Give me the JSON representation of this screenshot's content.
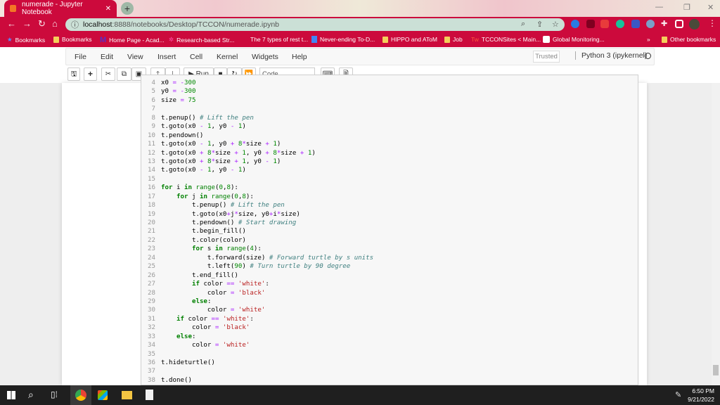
{
  "browser": {
    "tab_title": "numerade - Jupyter Notebook",
    "url_host": "localhost",
    "url_path": ":8888/notebooks/Desktop/TCCON/numerade.ipynb",
    "bookmarks": [
      "Bookmarks",
      "Bookmarks",
      "Home Page - Acad...",
      "Research-based Str...",
      "The 7 types of rest t...",
      "Never-ending To-D...",
      "HIPPO and AToM",
      "Job",
      "TCCONSites < Main...",
      "Global Monitoring..."
    ],
    "overflow": "»",
    "other_bookmarks": "Other bookmarks",
    "accent": "#cc0a3c"
  },
  "jupyter": {
    "menu": [
      "File",
      "Edit",
      "View",
      "Insert",
      "Cell",
      "Kernel",
      "Widgets",
      "Help"
    ],
    "trusted": "Trusted",
    "kernel": "Python 3 (ipykernel)",
    "run_label": "Run",
    "cell_type": "Code"
  },
  "code_lines": [
    {
      "n": "4",
      "t": [
        [
          "p",
          "x0 "
        ],
        [
          "o",
          "="
        ],
        [
          "p",
          " "
        ],
        [
          "o",
          "-"
        ],
        [
          "n",
          "300"
        ]
      ]
    },
    {
      "n": "5",
      "t": [
        [
          "p",
          "y0 "
        ],
        [
          "o",
          "="
        ],
        [
          "p",
          " "
        ],
        [
          "o",
          "-"
        ],
        [
          "n",
          "300"
        ]
      ]
    },
    {
      "n": "6",
      "t": [
        [
          "p",
          "size "
        ],
        [
          "o",
          "="
        ],
        [
          "p",
          " "
        ],
        [
          "n",
          "75"
        ]
      ]
    },
    {
      "n": "7",
      "t": []
    },
    {
      "n": "8",
      "t": [
        [
          "p",
          "t.penup() "
        ],
        [
          "c",
          "# Lift the pen"
        ]
      ]
    },
    {
      "n": "9",
      "t": [
        [
          "p",
          "t.goto(x0 "
        ],
        [
          "o",
          "-"
        ],
        [
          "p",
          " "
        ],
        [
          "n",
          "1"
        ],
        [
          "p",
          ", y0 "
        ],
        [
          "o",
          "-"
        ],
        [
          "p",
          " "
        ],
        [
          "n",
          "1"
        ],
        [
          "p",
          ")"
        ]
      ]
    },
    {
      "n": "10",
      "t": [
        [
          "p",
          "t.pendown()"
        ]
      ]
    },
    {
      "n": "11",
      "t": [
        [
          "p",
          "t.goto(x0 "
        ],
        [
          "o",
          "-"
        ],
        [
          "p",
          " "
        ],
        [
          "n",
          "1"
        ],
        [
          "p",
          ", y0 "
        ],
        [
          "o",
          "+"
        ],
        [
          "p",
          " "
        ],
        [
          "n",
          "8"
        ],
        [
          "o",
          "*"
        ],
        [
          "p",
          "size "
        ],
        [
          "o",
          "+"
        ],
        [
          "p",
          " "
        ],
        [
          "n",
          "1"
        ],
        [
          "p",
          ")"
        ]
      ]
    },
    {
      "n": "12",
      "t": [
        [
          "p",
          "t.goto(x0 "
        ],
        [
          "o",
          "+"
        ],
        [
          "p",
          " "
        ],
        [
          "n",
          "8"
        ],
        [
          "o",
          "*"
        ],
        [
          "p",
          "size "
        ],
        [
          "o",
          "+"
        ],
        [
          "p",
          " "
        ],
        [
          "n",
          "1"
        ],
        [
          "p",
          ", y0 "
        ],
        [
          "o",
          "+"
        ],
        [
          "p",
          " "
        ],
        [
          "n",
          "8"
        ],
        [
          "o",
          "*"
        ],
        [
          "p",
          "size "
        ],
        [
          "o",
          "+"
        ],
        [
          "p",
          " "
        ],
        [
          "n",
          "1"
        ],
        [
          "p",
          ")"
        ]
      ]
    },
    {
      "n": "13",
      "t": [
        [
          "p",
          "t.goto(x0 "
        ],
        [
          "o",
          "+"
        ],
        [
          "p",
          " "
        ],
        [
          "n",
          "8"
        ],
        [
          "o",
          "*"
        ],
        [
          "p",
          "size "
        ],
        [
          "o",
          "+"
        ],
        [
          "p",
          " "
        ],
        [
          "n",
          "1"
        ],
        [
          "p",
          ", y0 "
        ],
        [
          "o",
          "-"
        ],
        [
          "p",
          " "
        ],
        [
          "n",
          "1"
        ],
        [
          "p",
          ")"
        ]
      ]
    },
    {
      "n": "14",
      "t": [
        [
          "p",
          "t.goto(x0 "
        ],
        [
          "o",
          "-"
        ],
        [
          "p",
          " "
        ],
        [
          "n",
          "1"
        ],
        [
          "p",
          ", y0 "
        ],
        [
          "o",
          "-"
        ],
        [
          "p",
          " "
        ],
        [
          "n",
          "1"
        ],
        [
          "p",
          ")"
        ]
      ]
    },
    {
      "n": "15",
      "t": []
    },
    {
      "n": "16",
      "t": [
        [
          "k",
          "for"
        ],
        [
          "p",
          " i "
        ],
        [
          "k",
          "in"
        ],
        [
          "p",
          " "
        ],
        [
          "b",
          "range"
        ],
        [
          "p",
          "("
        ],
        [
          "n",
          "0"
        ],
        [
          "p",
          ","
        ],
        [
          "n",
          "8"
        ],
        [
          "p",
          "):"
        ]
      ]
    },
    {
      "n": "17",
      "t": [
        [
          "p",
          "    "
        ],
        [
          "k",
          "for"
        ],
        [
          "p",
          " j "
        ],
        [
          "k",
          "in"
        ],
        [
          "p",
          " "
        ],
        [
          "b",
          "range"
        ],
        [
          "p",
          "("
        ],
        [
          "n",
          "0"
        ],
        [
          "p",
          ","
        ],
        [
          "n",
          "8"
        ],
        [
          "p",
          "):"
        ]
      ]
    },
    {
      "n": "18",
      "t": [
        [
          "p",
          "        t.penup() "
        ],
        [
          "c",
          "# Lift the pen"
        ]
      ]
    },
    {
      "n": "19",
      "t": [
        [
          "p",
          "        t.goto(x0"
        ],
        [
          "o",
          "+"
        ],
        [
          "p",
          "j"
        ],
        [
          "o",
          "*"
        ],
        [
          "p",
          "size, y0"
        ],
        [
          "o",
          "+"
        ],
        [
          "p",
          "i"
        ],
        [
          "o",
          "*"
        ],
        [
          "p",
          "size)"
        ]
      ]
    },
    {
      "n": "20",
      "t": [
        [
          "p",
          "        t.pendown() "
        ],
        [
          "c",
          "# Start drawing"
        ]
      ]
    },
    {
      "n": "21",
      "t": [
        [
          "p",
          "        t.begin_fill()"
        ]
      ]
    },
    {
      "n": "22",
      "t": [
        [
          "p",
          "        t.color(color)"
        ]
      ]
    },
    {
      "n": "23",
      "t": [
        [
          "p",
          "        "
        ],
        [
          "k",
          "for"
        ],
        [
          "p",
          " s "
        ],
        [
          "k",
          "in"
        ],
        [
          "p",
          " "
        ],
        [
          "b",
          "range"
        ],
        [
          "p",
          "("
        ],
        [
          "n",
          "4"
        ],
        [
          "p",
          "):"
        ]
      ]
    },
    {
      "n": "24",
      "t": [
        [
          "p",
          "            t.forward(size) "
        ],
        [
          "c",
          "# Forward turtle by s units"
        ]
      ]
    },
    {
      "n": "25",
      "t": [
        [
          "p",
          "            t.left("
        ],
        [
          "n",
          "90"
        ],
        [
          "p",
          ") "
        ],
        [
          "c",
          "# Turn turtle by 90 degree"
        ]
      ]
    },
    {
      "n": "26",
      "t": [
        [
          "p",
          "        t.end_fill()"
        ]
      ]
    },
    {
      "n": "27",
      "t": [
        [
          "p",
          "        "
        ],
        [
          "k",
          "if"
        ],
        [
          "p",
          " color "
        ],
        [
          "o",
          "=="
        ],
        [
          "p",
          " "
        ],
        [
          "s",
          "'white'"
        ],
        [
          "p",
          ":"
        ]
      ]
    },
    {
      "n": "28",
      "t": [
        [
          "p",
          "            color "
        ],
        [
          "o",
          "="
        ],
        [
          "p",
          " "
        ],
        [
          "s",
          "'black'"
        ]
      ]
    },
    {
      "n": "29",
      "t": [
        [
          "p",
          "        "
        ],
        [
          "k",
          "else"
        ],
        [
          "p",
          ":"
        ]
      ]
    },
    {
      "n": "30",
      "t": [
        [
          "p",
          "            color "
        ],
        [
          "o",
          "="
        ],
        [
          "p",
          " "
        ],
        [
          "s",
          "'white'"
        ]
      ]
    },
    {
      "n": "31",
      "t": [
        [
          "p",
          "    "
        ],
        [
          "k",
          "if"
        ],
        [
          "p",
          " color "
        ],
        [
          "o",
          "=="
        ],
        [
          "p",
          " "
        ],
        [
          "s",
          "'white'"
        ],
        [
          "p",
          ":"
        ]
      ]
    },
    {
      "n": "32",
      "t": [
        [
          "p",
          "        color "
        ],
        [
          "o",
          "="
        ],
        [
          "p",
          " "
        ],
        [
          "s",
          "'black'"
        ]
      ]
    },
    {
      "n": "33",
      "t": [
        [
          "p",
          "    "
        ],
        [
          "k",
          "else"
        ],
        [
          "p",
          ":"
        ]
      ]
    },
    {
      "n": "34",
      "t": [
        [
          "p",
          "        color "
        ],
        [
          "o",
          "="
        ],
        [
          "p",
          " "
        ],
        [
          "s",
          "'white'"
        ]
      ]
    },
    {
      "n": "35",
      "t": []
    },
    {
      "n": "36",
      "t": [
        [
          "p",
          "t.hideturtle()"
        ]
      ]
    },
    {
      "n": "37",
      "t": []
    },
    {
      "n": "38",
      "t": [
        [
          "p",
          "t.done()"
        ]
      ]
    }
  ],
  "taskbar": {
    "time": "6:50 PM",
    "date": "9/21/2022"
  }
}
